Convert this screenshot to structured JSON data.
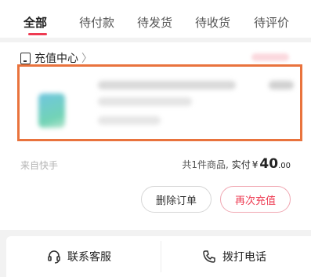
{
  "tabs": [
    {
      "label": "全部"
    },
    {
      "label": "待付款"
    },
    {
      "label": "待发货"
    },
    {
      "label": "待收货"
    },
    {
      "label": "待评价"
    }
  ],
  "active_tab": 0,
  "order": {
    "shop_name": "充值中心",
    "source": "来自快手",
    "summary": {
      "count_text": "共1件商品,",
      "paid_label": "实付",
      "currency": "¥",
      "amount_integer": "40",
      "amount_decimal": ".00"
    },
    "actions": {
      "delete_label": "删除订单",
      "recharge_label": "再次充值"
    }
  },
  "bottom_bar": {
    "service_label": "联系客服",
    "call_label": "拨打电话"
  },
  "colors": {
    "accent": "#ee3b52",
    "highlight_border": "#e9733d",
    "background": "#f2f2f2"
  },
  "icons": {
    "shop": "phone-device-icon",
    "service": "headset-icon",
    "call": "phone-icon"
  }
}
